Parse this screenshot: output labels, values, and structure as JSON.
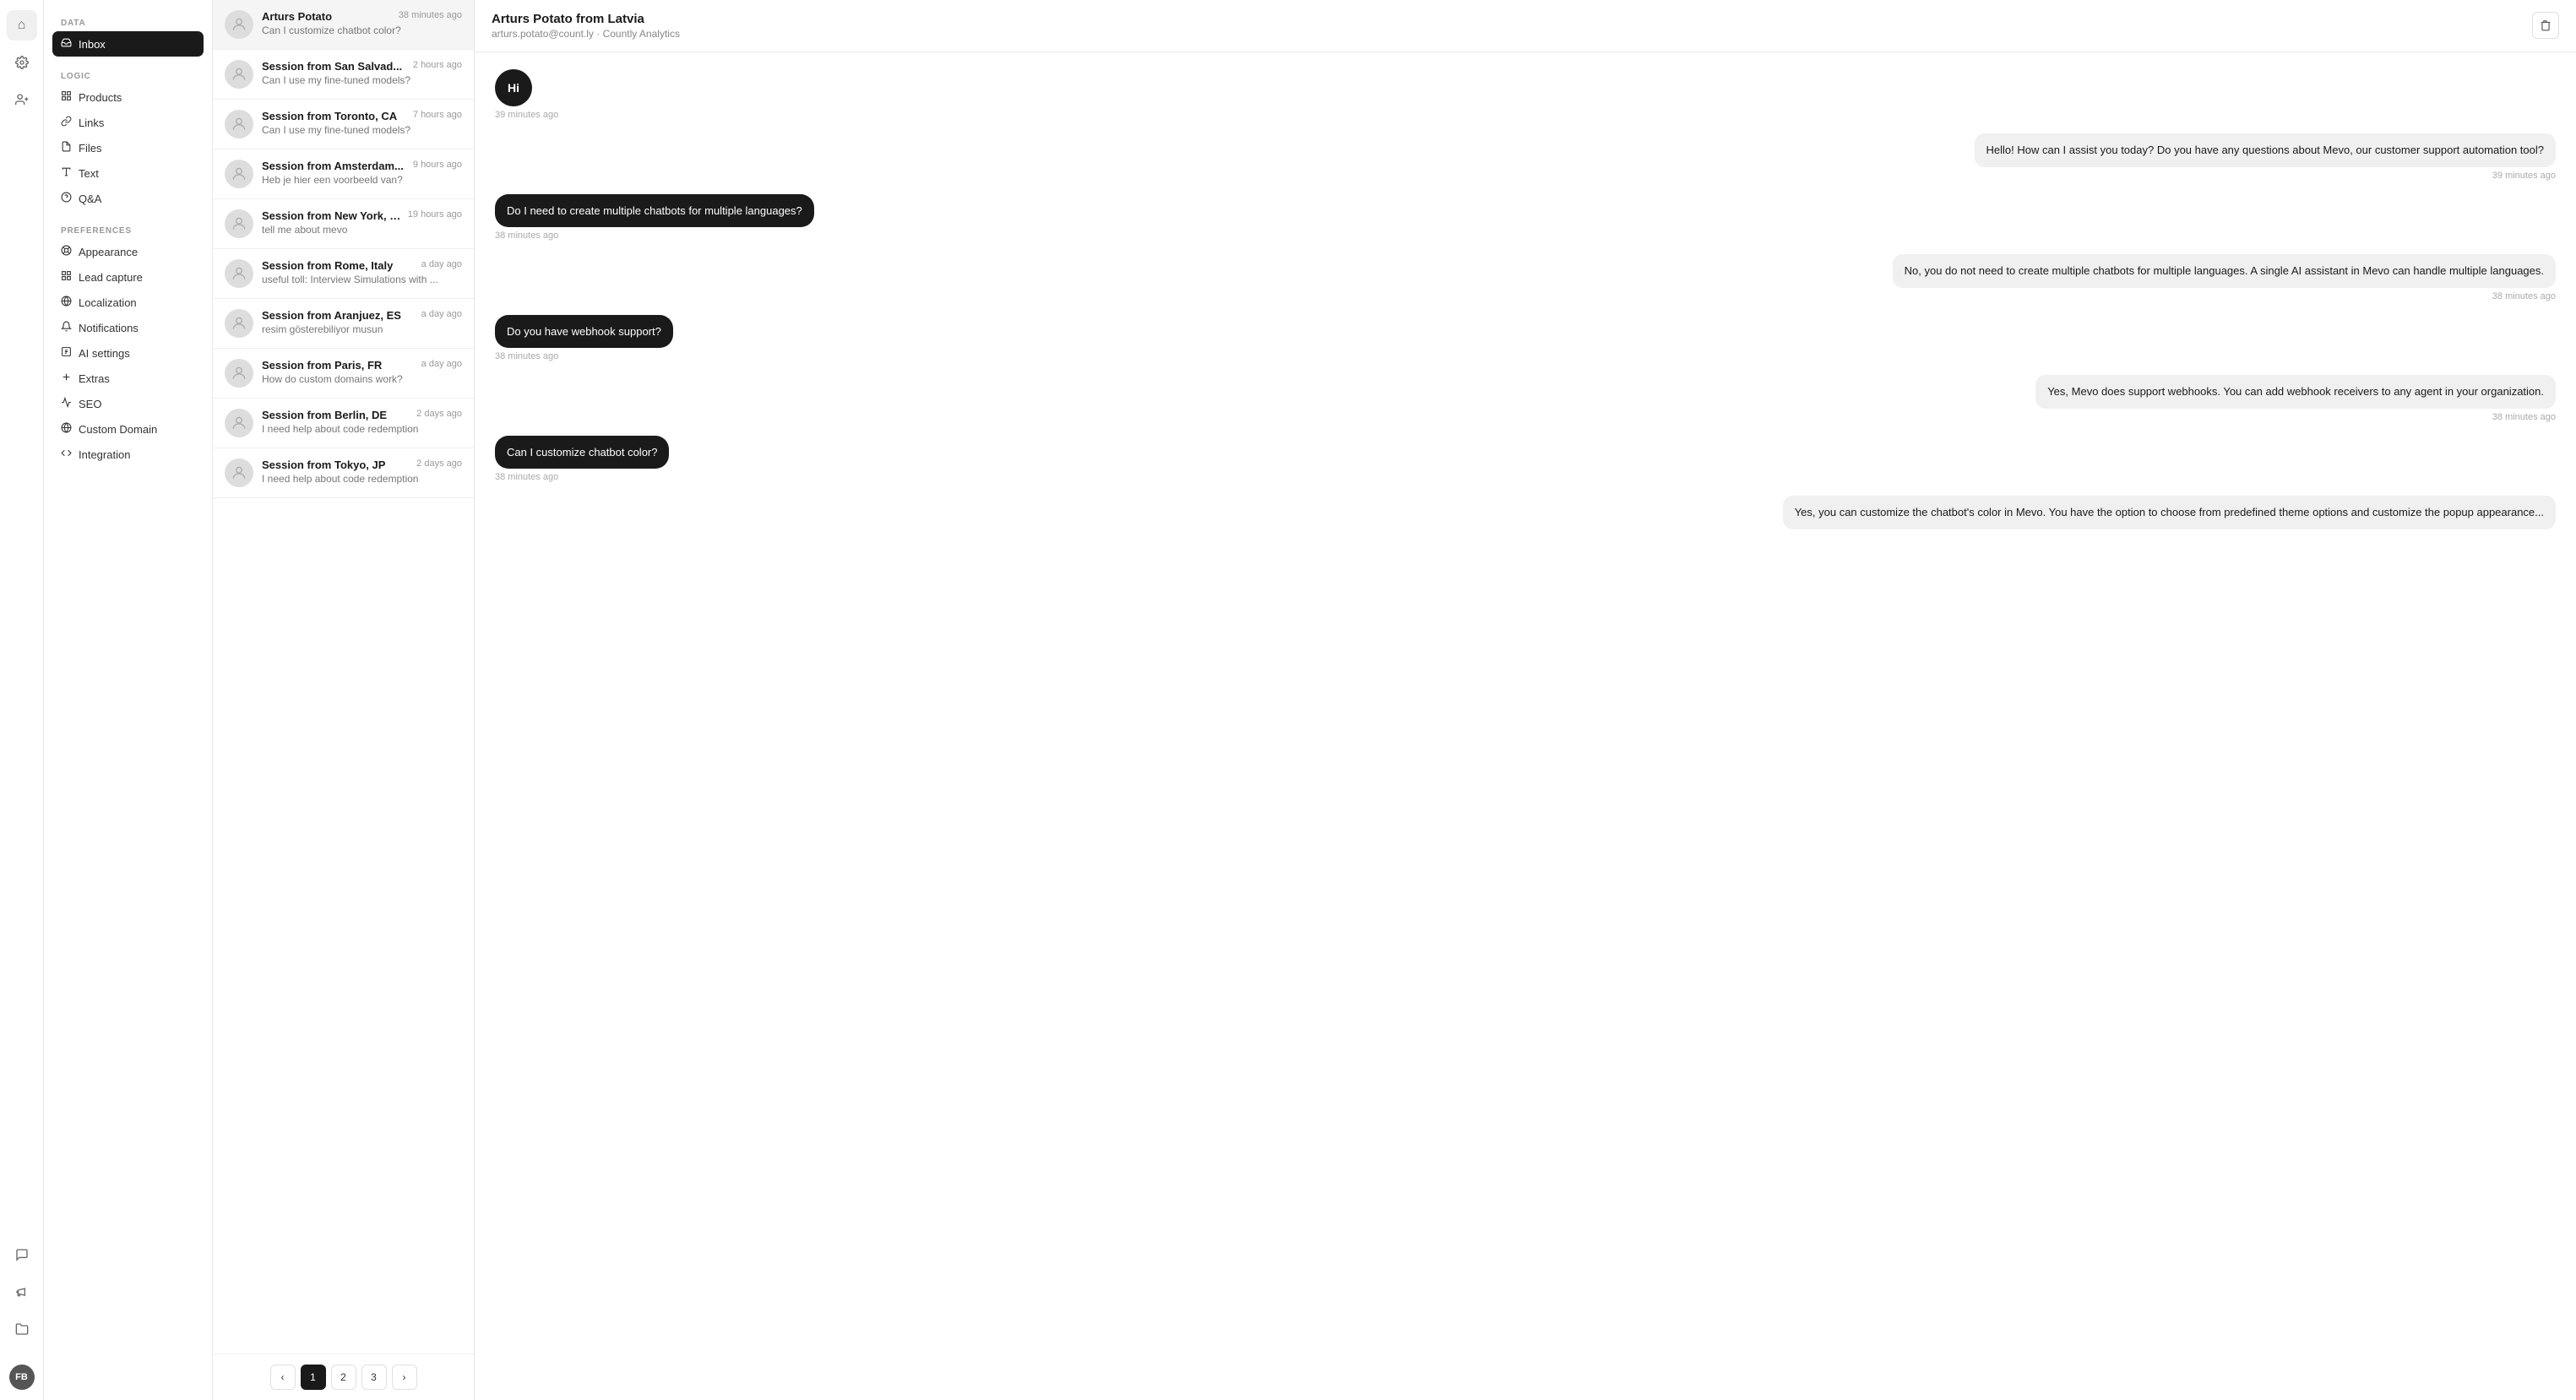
{
  "iconBar": {
    "items": [
      {
        "name": "home-icon",
        "glyph": "⌂",
        "active": true
      },
      {
        "name": "settings-icon",
        "glyph": "⚙"
      },
      {
        "name": "user-plus-icon",
        "glyph": "👤"
      }
    ],
    "bottom": [
      {
        "name": "chat-icon",
        "glyph": "💬"
      },
      {
        "name": "megaphone-icon",
        "glyph": "📣"
      },
      {
        "name": "folder-icon",
        "glyph": "📁"
      }
    ],
    "avatar": "FB"
  },
  "sidebar": {
    "sections": [
      {
        "label": "DATA",
        "items": [
          {
            "id": "inbox",
            "label": "Inbox",
            "icon": "inbox",
            "active": true
          }
        ]
      },
      {
        "label": "LOGIC",
        "items": [
          {
            "id": "products",
            "label": "Products",
            "icon": "widget"
          },
          {
            "id": "links",
            "label": "Links",
            "icon": "link"
          },
          {
            "id": "files",
            "label": "Files",
            "icon": "file"
          },
          {
            "id": "text",
            "label": "Text",
            "icon": "text"
          },
          {
            "id": "qanda",
            "label": "Q&A",
            "icon": "qanda"
          }
        ]
      },
      {
        "label": "PREFERENCES",
        "items": [
          {
            "id": "appearance",
            "label": "Appearance",
            "icon": "appearance"
          },
          {
            "id": "lead-capture",
            "label": "Lead capture",
            "icon": "grid"
          },
          {
            "id": "localization",
            "label": "Localization",
            "icon": "globe"
          },
          {
            "id": "notifications",
            "label": "Notifications",
            "icon": "bell"
          },
          {
            "id": "ai-settings",
            "label": "AI settings",
            "icon": "ai"
          },
          {
            "id": "extras",
            "label": "Extras",
            "icon": "plus"
          },
          {
            "id": "seo",
            "label": "SEO",
            "icon": "seo"
          },
          {
            "id": "custom-domain",
            "label": "Custom Domain",
            "icon": "globe2"
          },
          {
            "id": "integration",
            "label": "Integration",
            "icon": "code"
          }
        ]
      }
    ]
  },
  "convList": {
    "items": [
      {
        "id": 1,
        "name": "Arturs Potato",
        "time": "38 minutes ago",
        "preview": "Can I customize chatbot color?",
        "active": true
      },
      {
        "id": 2,
        "name": "Session from San Salvad...",
        "time": "2 hours ago",
        "preview": "Can I use my fine-tuned models?"
      },
      {
        "id": 3,
        "name": "Session from Toronto, CA",
        "time": "7 hours ago",
        "preview": "Can I use my fine-tuned models?"
      },
      {
        "id": 4,
        "name": "Session from Amsterdam...",
        "time": "9 hours ago",
        "preview": "Heb je hier een voorbeeld van?"
      },
      {
        "id": 5,
        "name": "Session from New York, US",
        "time": "19 hours ago",
        "preview": "tell me about mevo"
      },
      {
        "id": 6,
        "name": "Session from Rome, Italy",
        "time": "a day ago",
        "preview": "useful toll: Interview Simulations with ..."
      },
      {
        "id": 7,
        "name": "Session from Aranjuez, ES",
        "time": "a day ago",
        "preview": "resim gösterebiliyor musun"
      },
      {
        "id": 8,
        "name": "Session from Paris, FR",
        "time": "a day ago",
        "preview": "How do custom domains work?"
      },
      {
        "id": 9,
        "name": "Session from Berlin, DE",
        "time": "2 days ago",
        "preview": "I need help about code redemption"
      },
      {
        "id": 10,
        "name": "Session from Tokyo, JP",
        "time": "2 days ago",
        "preview": "I need help about code redemption"
      }
    ],
    "pagination": {
      "pages": [
        "1",
        "2",
        "3"
      ],
      "current": "1"
    }
  },
  "chat": {
    "header": {
      "name": "Arturs Potato from Latvia",
      "sub": "arturs.potato@count.ly · Countly Analytics"
    },
    "messages": [
      {
        "id": "m1",
        "type": "user",
        "content": "Hi",
        "style": "circle",
        "time": "39 minutes ago",
        "timeAlign": "left"
      },
      {
        "id": "m2",
        "type": "bot",
        "content": "Hello! How can I assist you today? Do you have any questions about Mevo, our customer support automation tool?",
        "time": "39 minutes ago",
        "timeAlign": "right"
      },
      {
        "id": "m3",
        "type": "user",
        "content": "Do I need to create multiple chatbots for multiple languages?",
        "time": "38 minutes ago",
        "timeAlign": "left"
      },
      {
        "id": "m4",
        "type": "bot",
        "content": "No, you do not need to create multiple chatbots for multiple languages. A single AI assistant in Mevo can handle multiple languages.",
        "time": "38 minutes ago",
        "timeAlign": "right"
      },
      {
        "id": "m5",
        "type": "user",
        "content": "Do you have webhook support?",
        "time": "38 minutes ago",
        "timeAlign": "left"
      },
      {
        "id": "m6",
        "type": "bot",
        "content": "Yes, Mevo does support webhooks. You can add webhook receivers to any agent in your organization.",
        "time": "38 minutes ago",
        "timeAlign": "right"
      },
      {
        "id": "m7",
        "type": "user",
        "content": "Can I customize chatbot color?",
        "time": "38 minutes ago",
        "timeAlign": "left"
      },
      {
        "id": "m8",
        "type": "bot",
        "content": "Yes, you can customize the chatbot's color in Mevo. You have the option to choose from predefined theme options and customize the popup appearance...",
        "time": "",
        "timeAlign": "right"
      }
    ]
  }
}
